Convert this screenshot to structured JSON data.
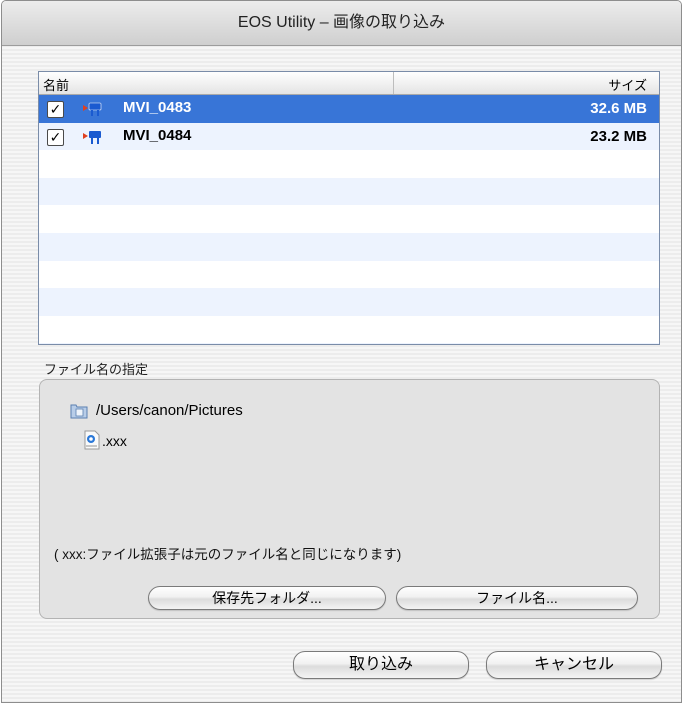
{
  "window": {
    "title": "EOS Utility – 画像の取り込み"
  },
  "file_list": {
    "columns": {
      "name": "名前",
      "size": "サイズ"
    },
    "rows": [
      {
        "checked": true,
        "selected": true,
        "icon": "movie-icon",
        "name": "MVI_0483",
        "size": "32.6 MB"
      },
      {
        "checked": true,
        "selected": false,
        "icon": "movie-icon",
        "name": "MVI_0484",
        "size": "23.2 MB"
      }
    ],
    "selection_color": "#3875d7",
    "stripe_color": "#edf3fe"
  },
  "filename_group": {
    "label": "ファイル名の指定",
    "folder_icon": "folder-icon",
    "folder_path": "/Users/canon/Pictures",
    "file_icon": "quicktime-file-icon",
    "file_ext": ".xxx",
    "note": "( xxx:ファイル拡張子は元のファイル名と同じになります)",
    "dest_button": "保存先フォルダ...",
    "filename_button": "ファイル名..."
  },
  "actions": {
    "import": "取り込み",
    "cancel": "キャンセル"
  }
}
